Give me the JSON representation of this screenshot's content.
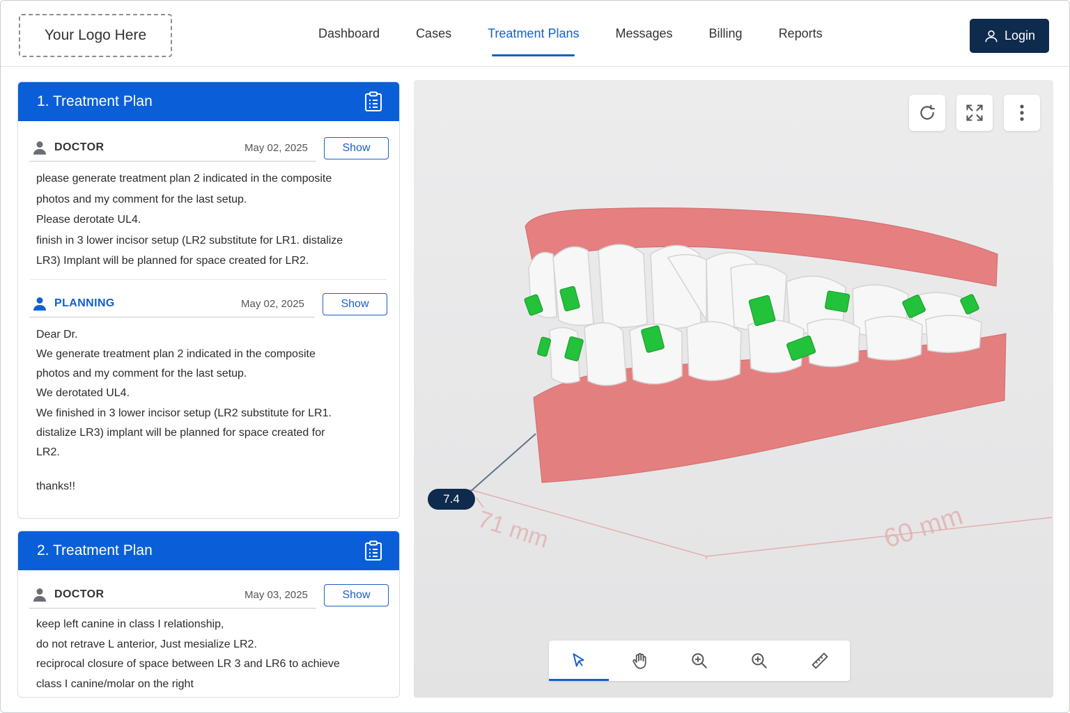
{
  "header": {
    "logo_text": "Your Logo Here",
    "nav": [
      "Dashboard",
      "Cases",
      "Treatment Plans",
      "Messages",
      "Billing",
      "Reports"
    ],
    "active_nav": "Treatment Plans",
    "login_label": "Login"
  },
  "plans": [
    {
      "title": "1. Treatment Plan",
      "entries": [
        {
          "role": "DOCTOR",
          "date": "May 02, 2025",
          "show_label": "Show",
          "lines": [
            "please generate treatment plan 2 indicated in the composite",
            "photos and my comment for the last setup.",
            "Please derotate UL4.",
            "finish in 3 lower incisor setup  (LR2 substitute for LR1. distalize",
            "LR3) Implant will be planned for space created for LR2."
          ]
        },
        {
          "role": "PLANNING",
          "date": "May 02, 2025",
          "show_label": "Show",
          "lines": [
            "Dear Dr.",
            "We generate treatment plan 2 indicated in the composite",
            "photos and my comment for the last setup.",
            "We derotated  UL4.",
            "We finished  in 3 lower incisor setup  (LR2 substitute for LR1.",
            "distalize LR3) implant will be planned for space created for",
            "LR2.",
            "",
            "thanks!!"
          ]
        }
      ]
    },
    {
      "title": "2. Treatment Plan",
      "entries": [
        {
          "role": "DOCTOR",
          "date": "May 03, 2025",
          "show_label": "Show",
          "lines": [
            "keep left canine in class I relationship,",
            "do not retrave L anterior, Just mesialize LR2.",
            "reciprocal closure of space between LR 3 and LR6 to achieve",
            "class I canine/molar on the right"
          ]
        }
      ]
    }
  ],
  "viewer": {
    "measurement": "7.4",
    "axis_label_left": "71 mm",
    "axis_label_right": "60 mm",
    "controls": [
      "rotate-reset-icon",
      "fullscreen-icon",
      "more-vertical-icon"
    ],
    "tools": [
      "select-pointer-icon",
      "pan-hand-icon",
      "zoom-in-icon",
      "zoom-icon",
      "ruler-icon"
    ],
    "active_tool": "select-pointer-icon"
  },
  "colors": {
    "brand_blue": "#0a5fd8",
    "navy": "#0e2a4d",
    "gum": "#e07c7c",
    "attachment_green": "#22c23a"
  }
}
